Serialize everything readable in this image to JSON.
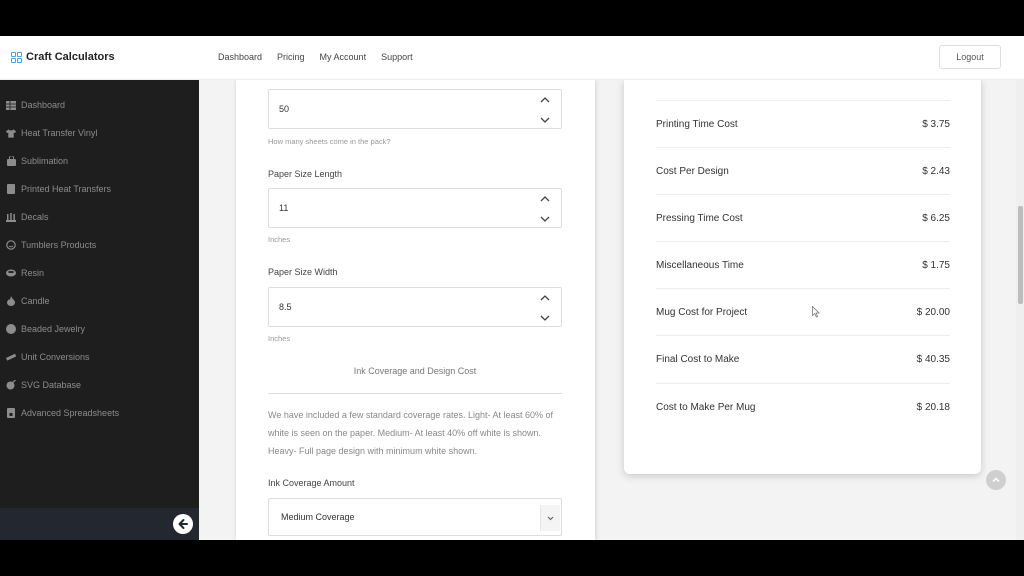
{
  "header": {
    "brand": "Craft Calculators",
    "nav": [
      "Dashboard",
      "Pricing",
      "My Account",
      "Support"
    ],
    "logout_label": "Logout"
  },
  "sidebar": {
    "items": [
      {
        "label": "Dashboard",
        "icon": "dashboard-icon"
      },
      {
        "label": "Heat Transfer Vinyl",
        "icon": "tshirt-icon"
      },
      {
        "label": "Sublimation",
        "icon": "bag-icon"
      },
      {
        "label": "Printed Heat Transfers",
        "icon": "document-icon"
      },
      {
        "label": "Decals",
        "icon": "decals-icon"
      },
      {
        "label": "Tumblers Products",
        "icon": "tumbler-icon"
      },
      {
        "label": "Resin",
        "icon": "resin-icon"
      },
      {
        "label": "Candle",
        "icon": "flame-icon"
      },
      {
        "label": "Beaded Jewelry",
        "icon": "bead-icon"
      },
      {
        "label": "Unit Conversions",
        "icon": "ruler-icon"
      },
      {
        "label": "SVG Database",
        "icon": "svg-icon"
      },
      {
        "label": "Advanced Spreadsheets",
        "icon": "spreadsheet-icon"
      }
    ],
    "collapse_icon": "arrow-left-circle-icon"
  },
  "form": {
    "sheets": {
      "value": "50",
      "help": "How many sheets come in the pack?"
    },
    "paper_length": {
      "label": "Paper Size Length",
      "value": "11",
      "help": "Inches"
    },
    "paper_width": {
      "label": "Paper Size Width",
      "value": "8.5",
      "help": "Inches"
    },
    "section_title": "Ink Coverage and Design Cost",
    "description": "We have included a few standard coverage rates. Light- At least 60% of white is seen on the paper. Medium- At least 40% off white is shown. Heavy- Full page design with minimum white shown.",
    "ink_coverage": {
      "label": "Ink Coverage Amount",
      "selected": "Medium Coverage"
    }
  },
  "results": [
    {
      "label": "Printing Time Cost",
      "amount": "$ 3.75"
    },
    {
      "label": "Cost Per Design",
      "amount": "$ 2.43"
    },
    {
      "label": "Pressing Time Cost",
      "amount": "$ 6.25"
    },
    {
      "label": "Miscellaneous Time",
      "amount": "$ 1.75"
    },
    {
      "label": "Mug Cost for Project",
      "amount": "$ 20.00"
    },
    {
      "label": "Final Cost to Make",
      "amount": "$ 40.35"
    },
    {
      "label": "Cost to Make Per Mug",
      "amount": "$ 20.18"
    }
  ],
  "colors": {
    "sidebar_bg": "#1e1e1e",
    "brand_icon": "#4aa3df",
    "page_bg": "#f3f3f3"
  }
}
